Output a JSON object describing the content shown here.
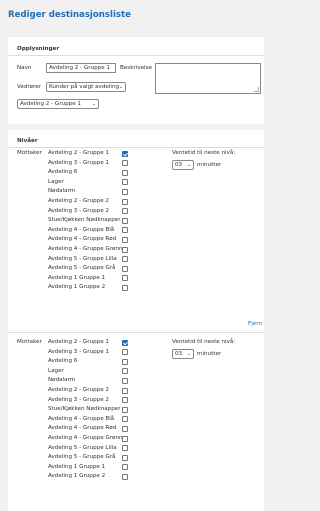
{
  "page": {
    "title": "Rediger destinasjonsliste"
  },
  "info": {
    "section_title": "Opplysninger",
    "name_label": "Navn",
    "name_value": "Avdeling 2 - Gruppe 1",
    "description_label": "Beskrivelse",
    "concerns_label": "Vedrører",
    "concerns_value": "Kunder på valgt avdeling",
    "department_value": "Avdeling 2 - Gruppe 1"
  },
  "levels": {
    "section_title": "Nivåer",
    "blocks": [
      {
        "recipient_label": "Mottaker",
        "wait_label": "Ventetid til neste nivå:",
        "wait_value": "03",
        "wait_unit": "minutter",
        "remove_label": "Fjern",
        "items": [
          {
            "label": "Avdeling 2 - Gruppe 1",
            "checked": true
          },
          {
            "label": "Avdeling 3 - Gruppe 1",
            "checked": false
          },
          {
            "label": "Avdeling 6",
            "checked": false
          },
          {
            "label": "Lager",
            "checked": false
          },
          {
            "label": "Nødalarm",
            "checked": false
          },
          {
            "label": "Avdeling 2 - Gruppe 2",
            "checked": false
          },
          {
            "label": "Avdeling 3 - Gruppe 2",
            "checked": false
          },
          {
            "label": "Stue/Kjøkken Nødknapper",
            "checked": false
          },
          {
            "label": "Avdeling 4 - Gruppe Blå",
            "checked": false
          },
          {
            "label": "Avdeling 4 - Gruppe Rød",
            "checked": false
          },
          {
            "label": "Avdeling 4 - Gruppe Grønn",
            "checked": false
          },
          {
            "label": "Avdeling 5 - Gruppe Lilla",
            "checked": false
          },
          {
            "label": "Avdeling 5 - Gruppe Grå",
            "checked": false
          },
          {
            "label": "Avdeling 1 Gruppe 1",
            "checked": false
          },
          {
            "label": "Avdeling 1 Gruppe 2",
            "checked": false
          }
        ]
      },
      {
        "recipient_label": "Mottaker",
        "wait_label": "Ventetid til neste nivå:",
        "wait_value": "03",
        "wait_unit": "minutter",
        "items": [
          {
            "label": "Avdeling 2 - Gruppe 1",
            "checked": true
          },
          {
            "label": "Avdeling 3 - Gruppe 1",
            "checked": false
          },
          {
            "label": "Avdeling 6",
            "checked": false
          },
          {
            "label": "Lager",
            "checked": false
          },
          {
            "label": "Nødalarm",
            "checked": false
          },
          {
            "label": "Avdeling 2 - Gruppe 2",
            "checked": false
          },
          {
            "label": "Avdeling 3 - Gruppe 2",
            "checked": false
          },
          {
            "label": "Stue/Kjøkken Nødknapper",
            "checked": false
          },
          {
            "label": "Avdeling 4 - Gruppe Blå",
            "checked": false
          },
          {
            "label": "Avdeling 4 - Gruppe Rød",
            "checked": false
          },
          {
            "label": "Avdeling 4 - Gruppe Grønn",
            "checked": false
          },
          {
            "label": "Avdeling 5 - Gruppe Lilla",
            "checked": false
          },
          {
            "label": "Avdeling 5 - Gruppe Grå",
            "checked": false
          },
          {
            "label": "Avdeling 1 Gruppe 1",
            "checked": false
          },
          {
            "label": "Avdeling 1 Gruppe 2",
            "checked": false
          }
        ]
      }
    ]
  }
}
